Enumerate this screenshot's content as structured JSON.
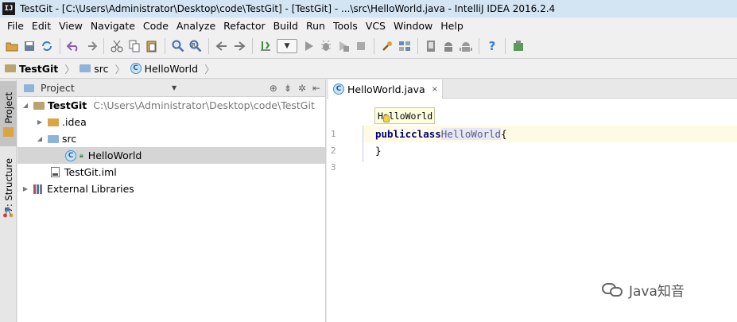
{
  "window": {
    "app_icon_label": "IJ",
    "title": "TestGit - [C:\\Users\\Administrator\\Desktop\\code\\TestGit] - [TestGit] - ...\\src\\HelloWorld.java - IntelliJ IDEA 2016.2.4"
  },
  "menu": {
    "items": [
      "File",
      "Edit",
      "View",
      "Navigate",
      "Code",
      "Analyze",
      "Refactor",
      "Build",
      "Run",
      "Tools",
      "VCS",
      "Window",
      "Help"
    ]
  },
  "toolbar": {
    "icons": [
      "open-folder-icon",
      "save-icon",
      "sync-icon",
      "undo-icon",
      "redo-icon",
      "cut-icon",
      "copy-icon",
      "paste-icon",
      "find-icon",
      "replace-icon",
      "back-icon",
      "forward-icon",
      "make-icon",
      "run-config-dropdown",
      "run-icon",
      "debug-icon",
      "coverage-icon",
      "stop-icon",
      "settings-icon",
      "project-structure-icon",
      "sdk-icon",
      "android-icon",
      "avd-icon",
      "help-icon",
      "plugin-icon"
    ]
  },
  "navbar": {
    "crumbs": [
      "TestGit",
      "src",
      "HelloWorld"
    ]
  },
  "side_tabs": {
    "project": "1: Project",
    "structure": "7: Structure"
  },
  "project_panel": {
    "title": "Project",
    "tree": {
      "root_name": "TestGit",
      "root_path": "C:\\Users\\Administrator\\Desktop\\code\\TestGit",
      "idea": ".idea",
      "src": "src",
      "class_file": "HelloWorld",
      "iml": "TestGit.iml",
      "libs": "External Libraries"
    }
  },
  "editor": {
    "tab_label": "HelloWorld.java",
    "tab_close": "×",
    "breadcrumb_tip": "HelloWorld",
    "line_numbers": [
      "1",
      "2",
      "3"
    ],
    "code": {
      "kw_public": "public",
      "kw_class": "class",
      "class_name": "HelloWorld",
      "open_brace": "{",
      "close_brace": "}"
    }
  },
  "watermark": {
    "text": "Java知音"
  },
  "colors": {
    "titlebar_bg": "#d3e4f3",
    "keyword": "#000080",
    "current_line": "#fffae3",
    "selected_row": "#d5d5d5"
  }
}
